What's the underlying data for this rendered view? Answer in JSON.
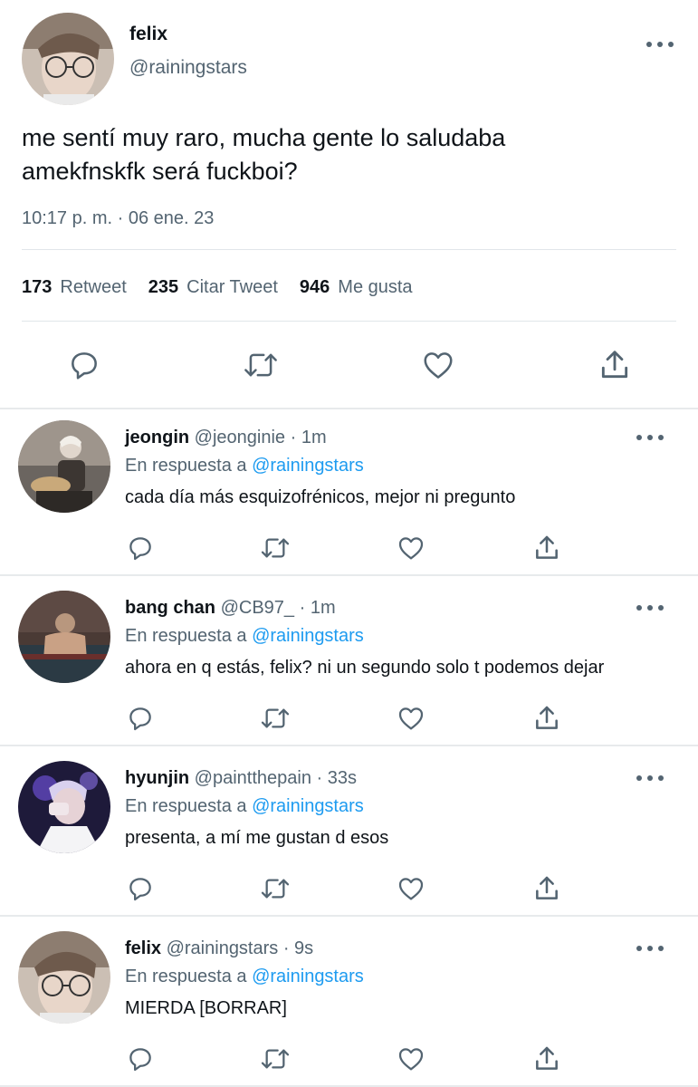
{
  "tweet": {
    "author_name": "felix",
    "author_handle": "@rainingstars",
    "text_line1": "me sentí muy raro, mucha gente lo saludaba",
    "text_line2": "amekfnskfk será fuckboi?",
    "timestamp": "10:17 p. m. · 06 ene. 23",
    "stats": {
      "retweets_count": "173",
      "retweets_label": "Retweet",
      "quotes_count": "235",
      "quotes_label": "Citar Tweet",
      "likes_count": "946",
      "likes_label": "Me gusta"
    }
  },
  "reply_prefix": "En respuesta a",
  "replies": [
    {
      "name": "jeongin",
      "handle": "@jeonginie",
      "time": "· 1m",
      "mention": "@rainingstars",
      "text": "cada día más esquizofrénicos, mejor ni pregunto"
    },
    {
      "name": "bang chan",
      "handle": "@CB97_",
      "time": "· 1m",
      "mention": "@rainingstars",
      "text": "ahora en q estás, felix? ni un segundo solo t podemos dejar"
    },
    {
      "name": "hyunjin",
      "handle": "@paintthepain",
      "time": "· 33s",
      "mention": "@rainingstars",
      "text": "presenta, a mí me gustan d esos"
    },
    {
      "name": "felix",
      "handle": "@rainingstars",
      "time": "· 9s",
      "mention": "@rainingstars",
      "text": "MIERDA [BORRAR]"
    }
  ],
  "icons": {
    "reply": "reply-icon",
    "retweet": "retweet-icon",
    "like": "heart-icon",
    "share": "share-icon",
    "more": "more-icon"
  },
  "colors": {
    "text": "#0f1419",
    "secondary": "#536471",
    "link": "#1d9bf0",
    "divider": "#e1e6ea"
  }
}
